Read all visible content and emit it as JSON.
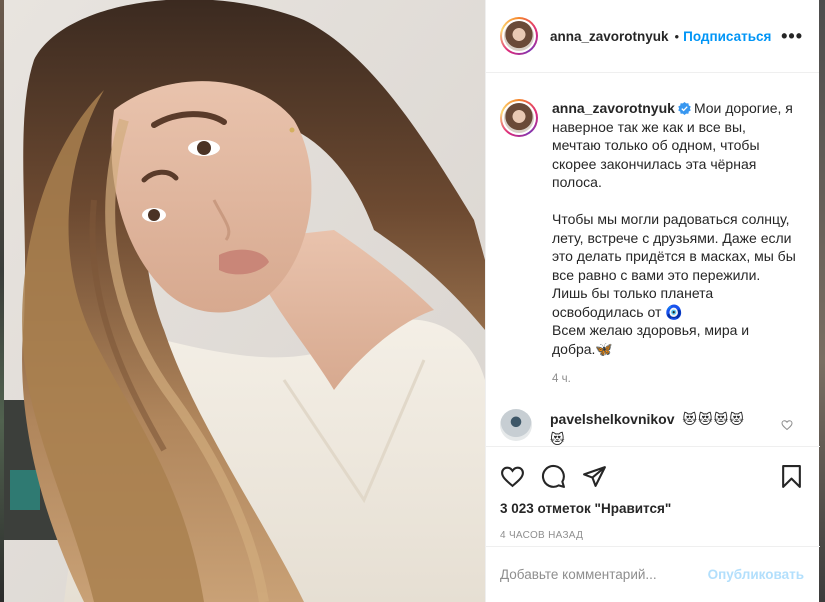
{
  "post": {
    "username": "anna_zavorotnyuk",
    "follow_label": "Подписаться",
    "dot": "•",
    "more_label": "•••"
  },
  "caption": {
    "username": "anna_zavorotnyuk",
    "lines": [
      "Мои дорогие, я",
      "наверное так же как и все вы,",
      "мечтаю только об одном, чтобы",
      "скорее закончилась эта чёрная",
      "полоса.",
      "",
      "Чтобы мы могли радоваться солнцу,",
      "лету, встрече с друзьями. Даже если",
      "это делать придётся в масках, мы бы",
      "все равно с вами это пережили.",
      "Лишь бы только планета",
      "освободилась от 🧿",
      "Всем желаю здоровья, мира и",
      "добра.🦋"
    ],
    "time": "4 ч."
  },
  "comment": {
    "username": "pavelshelkovnikov",
    "text": "😻😻😻😻😻"
  },
  "likes_text": "3 023 отметок \"Нравится\"",
  "time_ago": "4 ЧАСОВ НАЗАД",
  "add_comment": {
    "placeholder": "Добавьте комментарий...",
    "publish_label": "Опубликовать"
  },
  "colors": {
    "link_blue": "#0095f6",
    "publish_disabled": "#b2dffc",
    "muted": "#8e8e8e"
  },
  "icons": [
    "heart-icon",
    "comment-icon",
    "share-icon",
    "bookmark-icon",
    "more-icon",
    "verified-icon"
  ]
}
